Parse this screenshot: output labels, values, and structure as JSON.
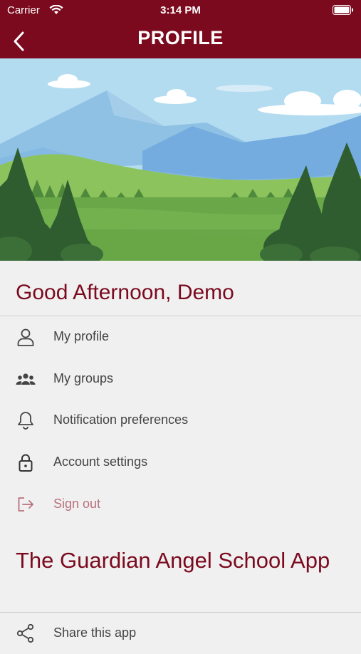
{
  "status_bar": {
    "carrier": "Carrier",
    "time": "3:14 PM"
  },
  "nav": {
    "title": "PROFILE",
    "back_icon": "chevron-left-icon"
  },
  "colors": {
    "brand": "#7b0a1e",
    "background": "#f0f0f0",
    "text": "#444444",
    "signout": "#b9707c"
  },
  "greeting": "Good Afternoon, Demo",
  "menu": [
    {
      "label": "My profile",
      "icon": "person-icon"
    },
    {
      "label": "My groups",
      "icon": "group-icon"
    },
    {
      "label": "Notification preferences",
      "icon": "bell-icon"
    },
    {
      "label": "Account settings",
      "icon": "lock-icon"
    },
    {
      "label": "Sign out",
      "icon": "sign-out-icon"
    }
  ],
  "school_title": "The Guardian Angel School App",
  "app_menu": [
    {
      "label": "Share this app",
      "icon": "share-icon"
    }
  ]
}
